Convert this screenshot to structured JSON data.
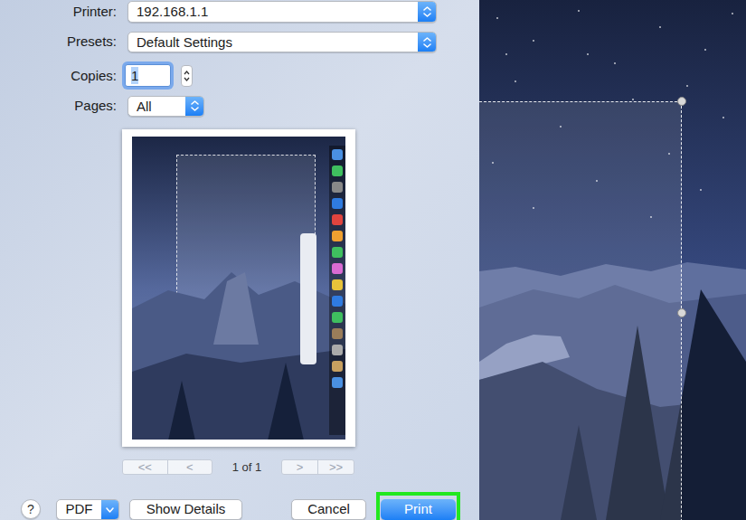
{
  "printer": {
    "label": "Printer:",
    "value": "192.168.1.1"
  },
  "presets": {
    "label": "Presets:",
    "value": "Default Settings"
  },
  "copies": {
    "label": "Copies:",
    "value": "1",
    "focused": true
  },
  "pages": {
    "label": "Pages:",
    "value": "All"
  },
  "preview": {
    "page_indicator": "1 of 1",
    "nav_buttons": [
      {
        "label": "<<",
        "disabled": true
      },
      {
        "label": "<",
        "disabled": true
      },
      {
        "label": ">",
        "disabled": true
      },
      {
        "label": ">>",
        "disabled": true
      }
    ]
  },
  "buttons": [
    {
      "label": "?",
      "kind": "help",
      "highlighted": false
    },
    {
      "label": "PDF",
      "kind": "menu",
      "highlighted": false
    },
    {
      "label": "Show Details",
      "kind": "plain",
      "highlighted": false
    },
    {
      "label": "Cancel",
      "kind": "plain",
      "highlighted": false
    },
    {
      "label": "Print",
      "kind": "default",
      "highlighted": true
    }
  ]
}
